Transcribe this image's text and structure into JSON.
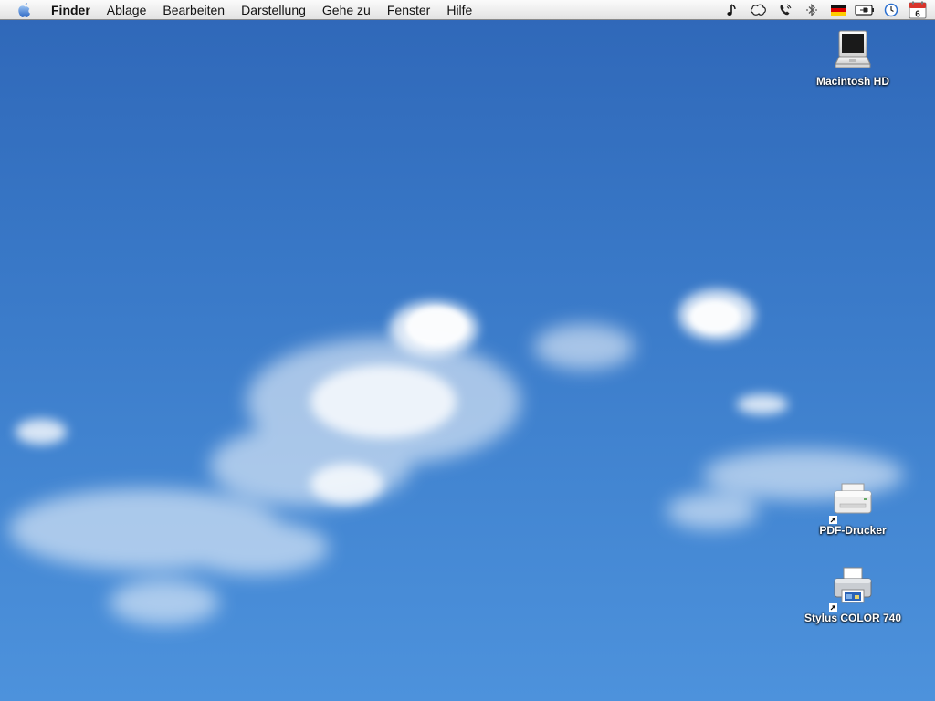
{
  "menubar": {
    "apple_icon": "apple-logo-icon",
    "items": [
      "Finder",
      "Ablage",
      "Bearbeiten",
      "Darstellung",
      "Gehe zu",
      "Fenster",
      "Hilfe"
    ],
    "status_icons": [
      "itunes-note-icon",
      "airport-icon",
      "phone-icon",
      "bluetooth-icon",
      "german-flag-icon",
      "battery-power-icon",
      "clock-icon",
      "calendar-icon"
    ],
    "calendar_day": "6"
  },
  "desktop": {
    "icons": [
      {
        "label": "Macintosh HD",
        "icon": "hard-drive-icon"
      },
      {
        "label": "PDF-Drucker",
        "icon": "printer-icon"
      },
      {
        "label": "Stylus COLOR 740",
        "icon": "inkjet-printer-icon"
      }
    ]
  },
  "colors": {
    "sky_top": "#2f67b8",
    "sky_bottom": "#4d92dc",
    "menubar": "#efefef"
  }
}
